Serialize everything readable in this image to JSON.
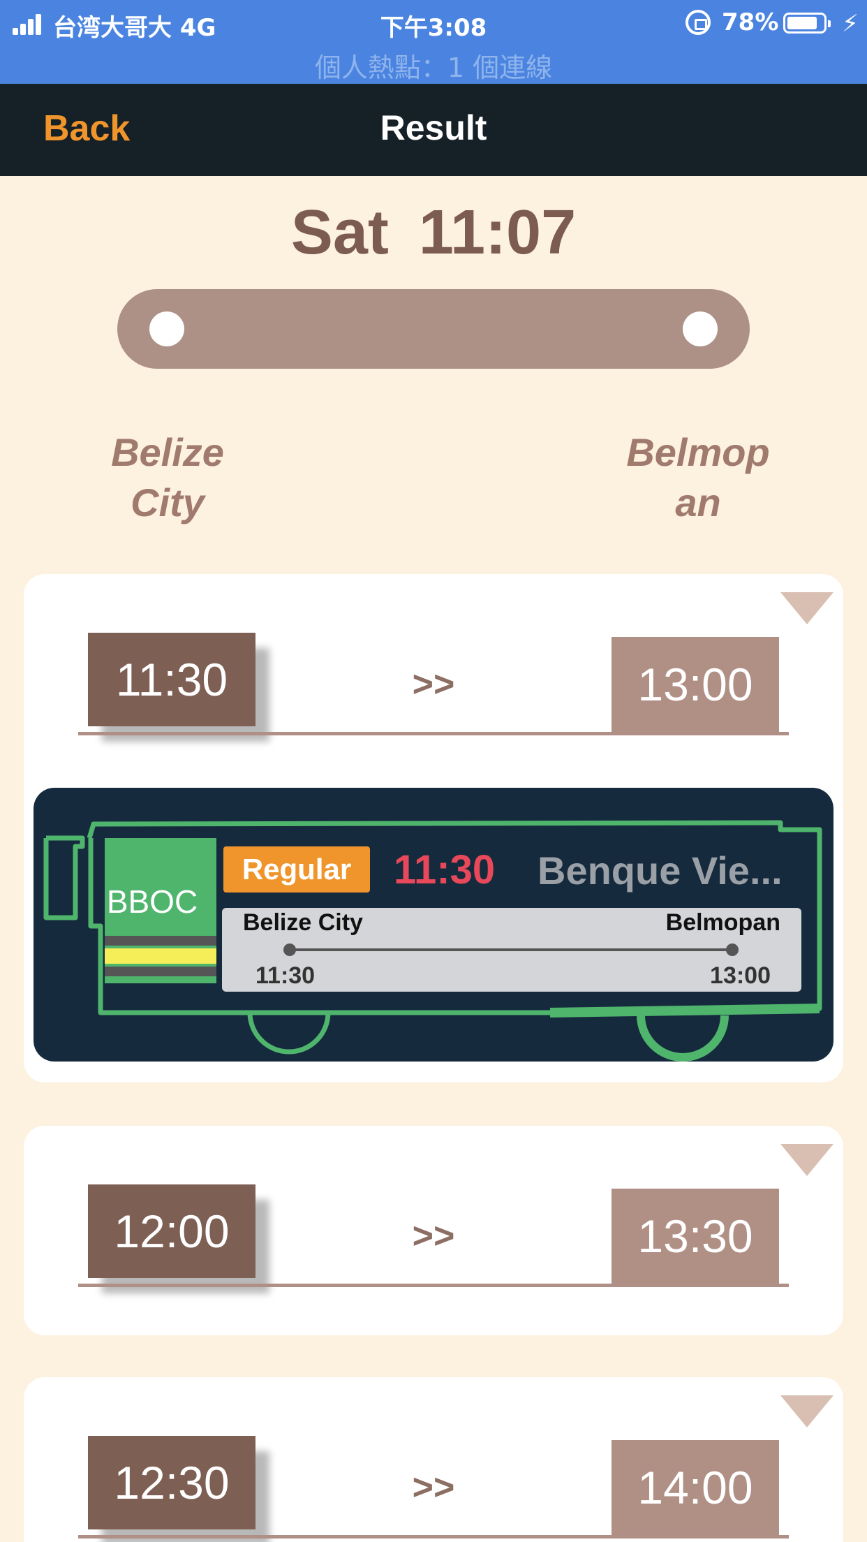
{
  "status_bar": {
    "carrier": "台湾大哥大   4G",
    "time": "下午3:08",
    "battery": "78%",
    "hotspot": "個人熱點：1 個連線"
  },
  "nav": {
    "back_label": "Back",
    "title": "Result"
  },
  "header": {
    "day": "Sat",
    "time": "11:07",
    "from_city": "Belize City",
    "to_city": "Belmopan"
  },
  "trips": [
    {
      "depart": "11:30",
      "arrow": ">>",
      "arrive": "13:00",
      "details": {
        "logo": "BBOC",
        "type": "Regular",
        "time": "11:30",
        "destination": "Benque Vie...",
        "from": "Belize City",
        "to": "Belmopan",
        "from_time": "11:30",
        "to_time": "13:00"
      }
    },
    {
      "depart": "12:00",
      "arrow": ">>",
      "arrive": "13:30"
    },
    {
      "depart": "12:30",
      "arrow": ">>",
      "arrive": "14:00"
    }
  ],
  "colors": {
    "status_bar": "#4a84e0",
    "nav_bar": "#162027",
    "back_accent": "#f0952c",
    "background": "#fdf1e0",
    "depart_box": "#7e5f54",
    "arrive_box": "#b08f85",
    "bus_panel": "#162a3e",
    "bus_outline": "#4fb56c",
    "bus_time": "#e8495a"
  }
}
